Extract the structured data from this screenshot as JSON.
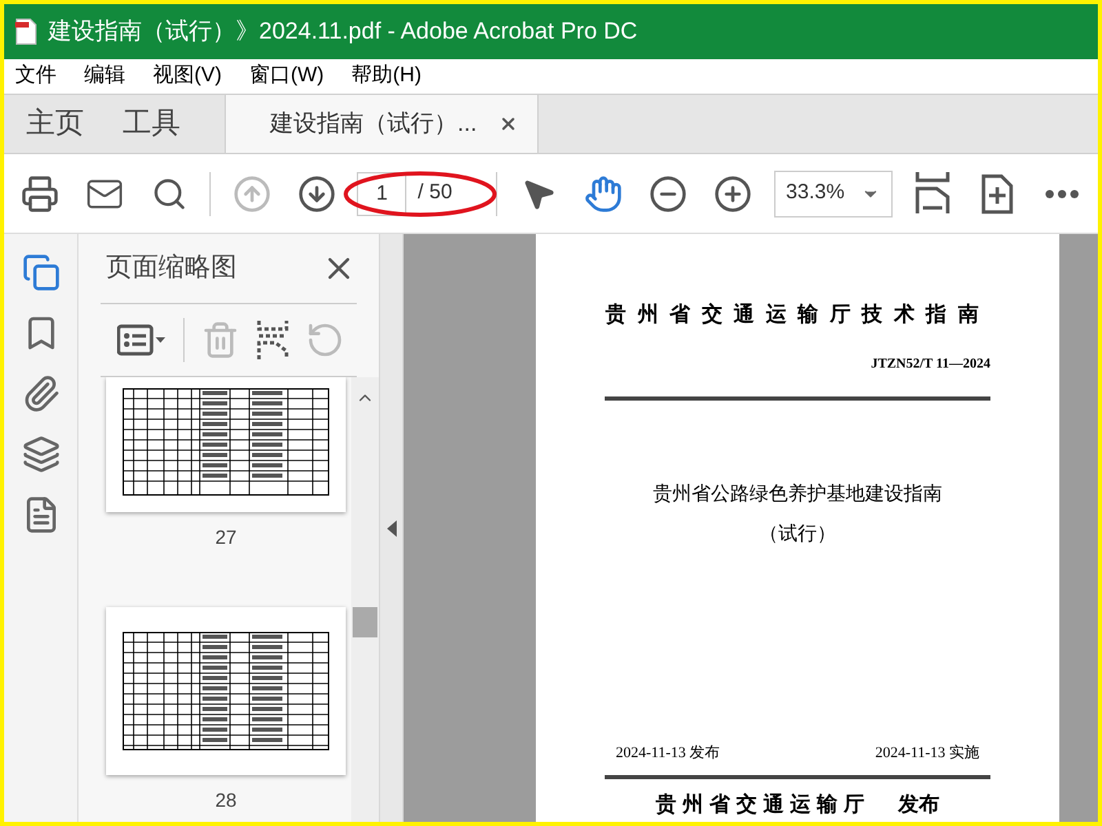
{
  "window": {
    "title": "建设指南（试行）》2024.11.pdf - Adobe Acrobat Pro DC"
  },
  "menu": [
    "文件",
    "编辑",
    "视图(V)",
    "窗口(W)",
    "帮助(H)"
  ],
  "tabs": [
    {
      "label": "主页",
      "kind": "home",
      "selected": false
    },
    {
      "label": "工具",
      "kind": "home",
      "selected": false
    },
    {
      "label": "建设指南（试行）...",
      "kind": "document",
      "selected": true
    }
  ],
  "toolbar": {
    "prev_page": {
      "disabled": true
    },
    "next_page": {
      "disabled": false
    },
    "page": "1",
    "page_total": "/ 50",
    "tools": [
      {
        "kind": "select",
        "selected": false
      },
      {
        "kind": "hand",
        "selected": true
      }
    ],
    "zoom": "33.3%"
  },
  "side_rail": [
    {
      "kind": "pages",
      "selected": true
    },
    {
      "kind": "bookmark",
      "selected": false
    },
    {
      "kind": "attachment",
      "selected": false
    },
    {
      "kind": "layers",
      "selected": false
    },
    {
      "kind": "document",
      "selected": false
    }
  ],
  "panel": {
    "title": "页面缩略图",
    "delete_disabled": true,
    "rotate_disabled": true,
    "thumbnails": [
      {
        "label": "27",
        "cut": true
      },
      {
        "label": "28",
        "cut": false
      }
    ]
  },
  "document": {
    "header": "贵州省交通运输厅技术指南",
    "code": "JTZN52/T 11—2024",
    "title": "贵州省公路绿色养护基地建设指南",
    "subtitle": "（试行）",
    "issue_date": "2024-11-13",
    "issue_label": "发布",
    "effective_date": "2024-11-13",
    "effective_label": "实施",
    "footer": "贵州省交通运输厅",
    "footer_label": "发布"
  }
}
